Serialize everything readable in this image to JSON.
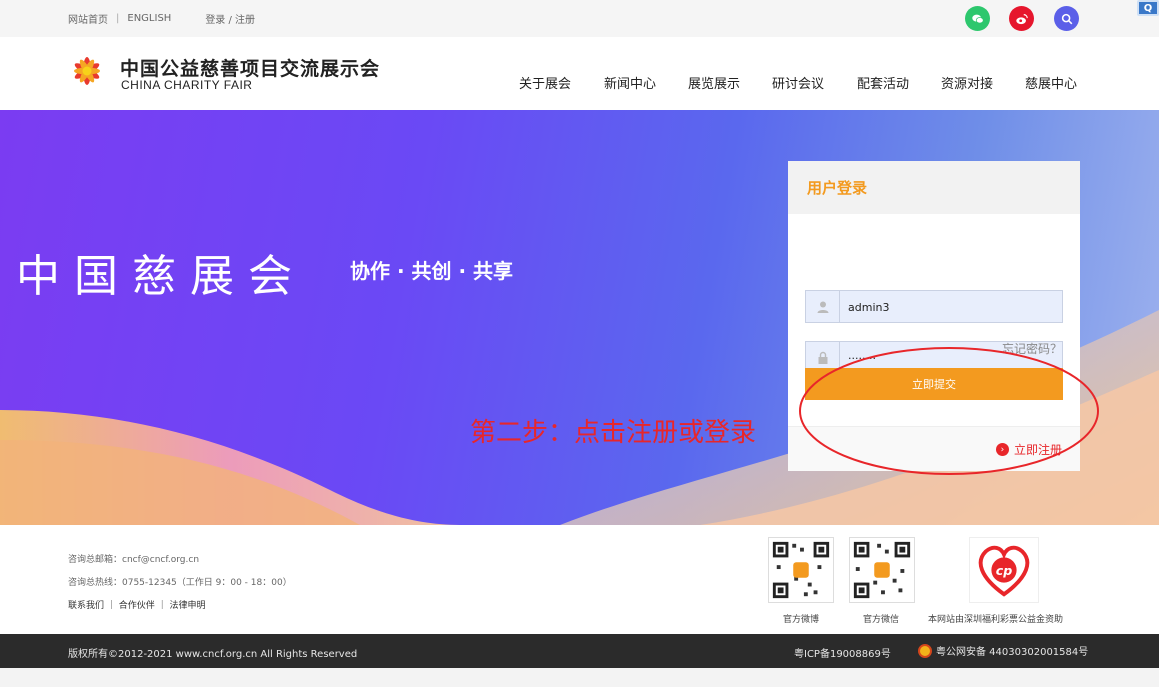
{
  "topbar": {
    "home_link": "网站首页",
    "separator": "|",
    "english_link": "ENGLISH",
    "login_register_link": "登录 / 注册",
    "social": [
      {
        "name": "wechat-icon",
        "color": "#2dc76d"
      },
      {
        "name": "weibo-icon",
        "color": "#e6162d"
      },
      {
        "name": "search-icon",
        "color": "#5b5fe8"
      }
    ],
    "corner_icon": "Q"
  },
  "header": {
    "logo_cn": "中国公益慈善项目交流展示会",
    "logo_en": "CHINA CHARITY FAIR",
    "nav": [
      "关于展会",
      "新闻中心",
      "展览展示",
      "研讨会议",
      "配套活动",
      "资源对接",
      "慈展中心"
    ]
  },
  "banner": {
    "title": "中国慈展会",
    "slogan": "协作 · 共创 · 共享",
    "annotation": "第二步：点击注册或登录"
  },
  "login": {
    "heading": "用户登录",
    "username_value": "admin3",
    "password_value": "········",
    "forgot_link": "忘记密码？",
    "submit_label": "立即提交",
    "register_link": "立即注册",
    "accent_color": "#f39a1f"
  },
  "footer": {
    "email": "咨询总邮箱：cncf@cncf.org.cn",
    "hotline": "咨询总热线：0755-12345（工作日 9：00 - 18：00）",
    "links": "联系我们 ｜ 合作伙伴 ｜ 法律申明",
    "qr_weibo_label": "官方微博",
    "qr_wechat_label": "官方微信",
    "sponsor_label": "本网站由深圳福利彩票公益金资助",
    "copyright": "版权所有©2012-2021 www.cncf.org.cn All Rights Reserved",
    "icp": "粤ICP备19008869号",
    "police": "粤公网安备 44030302001584号"
  }
}
